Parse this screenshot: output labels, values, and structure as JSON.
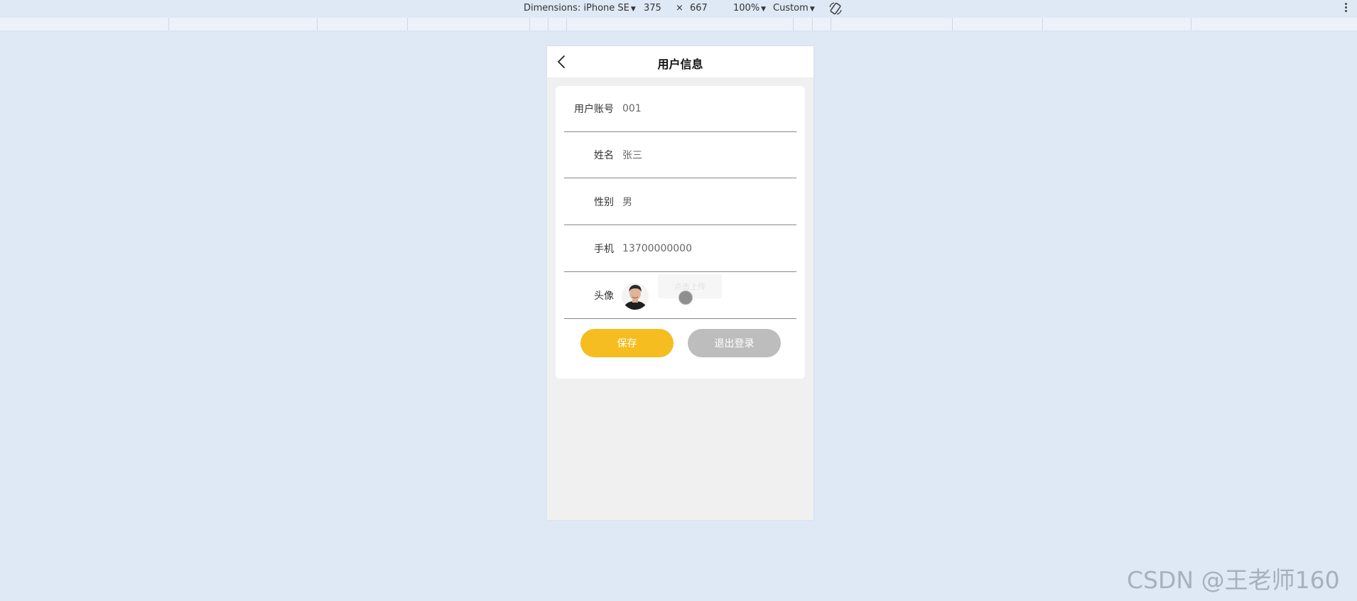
{
  "devtools": {
    "dimensions_label": "Dimensions: iPhone SE",
    "width": "375",
    "times": "×",
    "height": "667",
    "zoom": "100%",
    "throttle": "Custom"
  },
  "page": {
    "title": "用户信息",
    "fields": [
      {
        "label": "用户账号",
        "value": "001"
      },
      {
        "label": "姓名",
        "value": "张三"
      },
      {
        "label": "性别",
        "value": "男"
      },
      {
        "label": "手机",
        "value": "13700000000"
      }
    ],
    "avatar_label": "头像",
    "upload_hint": "点击上传",
    "save_label": "保存",
    "logout_label": "退出登录"
  },
  "watermark": "CSDN @王老师160",
  "colors": {
    "save": "#f5bd1f",
    "logout": "#bdbdbd",
    "page_bg": "#dfe8f5"
  }
}
